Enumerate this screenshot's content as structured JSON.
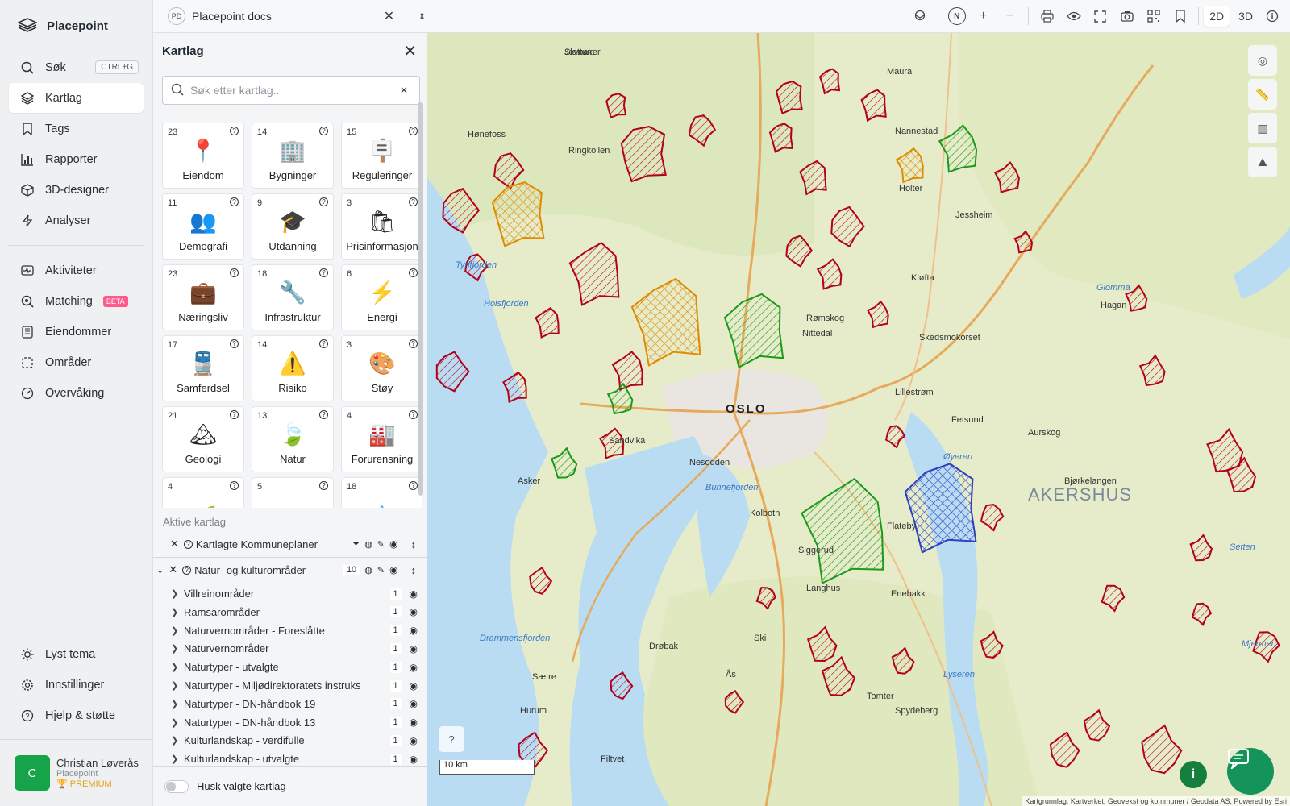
{
  "app": {
    "name": "Placepoint"
  },
  "nav": {
    "search": {
      "label": "Søk",
      "shortcut": "CTRL+G"
    },
    "items_top": [
      {
        "label": "Kartlag",
        "icon": "layers-icon",
        "active": true
      },
      {
        "label": "Tags",
        "icon": "bookmark-icon"
      },
      {
        "label": "Rapporter",
        "icon": "bar-chart-icon"
      },
      {
        "label": "3D-designer",
        "icon": "cube-icon"
      },
      {
        "label": "Analyser",
        "icon": "bolt-icon"
      }
    ],
    "items_mid": [
      {
        "label": "Aktiviteter",
        "icon": "activity-icon"
      },
      {
        "label": "Matching",
        "icon": "match-search-icon",
        "badge": "BETA"
      },
      {
        "label": "Eiendommer",
        "icon": "building-icon"
      },
      {
        "label": "Områder",
        "icon": "area-select-icon"
      },
      {
        "label": "Overvåking",
        "icon": "gauge-icon"
      }
    ],
    "items_bottom": [
      {
        "label": "Lyst tema",
        "icon": "sun-icon"
      },
      {
        "label": "Innstillinger",
        "icon": "gear-icon"
      },
      {
        "label": "Hjelp & støtte",
        "icon": "help-icon"
      }
    ]
  },
  "user": {
    "initial": "C",
    "name": "Christian Løverås",
    "org": "Placepoint",
    "plan": "PREMIUM"
  },
  "topbar": {
    "workspace_badge": "PD",
    "workspace_title": "Placepoint docs",
    "view_2d": "2D",
    "view_3d": "3D",
    "compass": "N"
  },
  "panel": {
    "title": "Kartlag",
    "search_placeholder": "Søk etter kartlag..",
    "categories": [
      {
        "count": "23",
        "label": "Eiendom",
        "emoji": "📍"
      },
      {
        "count": "14",
        "label": "Bygninger",
        "emoji": "🏢"
      },
      {
        "count": "15",
        "label": "Reguleringer",
        "emoji": "🪧"
      },
      {
        "count": "11",
        "label": "Demografi",
        "emoji": "👥"
      },
      {
        "count": "9",
        "label": "Utdanning",
        "emoji": "🎓"
      },
      {
        "count": "3",
        "label": "Prisinformasjon",
        "emoji": "🛍"
      },
      {
        "count": "23",
        "label": "Næringsliv",
        "emoji": "💼"
      },
      {
        "count": "18",
        "label": "Infrastruktur",
        "emoji": "🔧"
      },
      {
        "count": "6",
        "label": "Energi",
        "emoji": "⚡"
      },
      {
        "count": "17",
        "label": "Samferdsel",
        "emoji": "🚆"
      },
      {
        "count": "14",
        "label": "Risiko",
        "emoji": "⚠️"
      },
      {
        "count": "3",
        "label": "Støy",
        "emoji": "🎨"
      },
      {
        "count": "21",
        "label": "Geologi",
        "emoji": "🏔"
      },
      {
        "count": "13",
        "label": "Natur",
        "emoji": "🍃"
      },
      {
        "count": "4",
        "label": "Forurensning",
        "emoji": "🏭"
      },
      {
        "count": "4",
        "label": "",
        "emoji": "🌱"
      },
      {
        "count": "5",
        "label": "",
        "emoji": "🐟"
      },
      {
        "count": "18",
        "label": "",
        "emoji": "💧"
      }
    ],
    "active_title": "Aktive kartlag",
    "active_layers": [
      {
        "name": "Kartlagte Kommuneplaner"
      },
      {
        "name": "Natur- og kulturområder",
        "count": "10"
      }
    ],
    "sublayers": [
      {
        "name": "Villreinområder",
        "count": "1"
      },
      {
        "name": "Ramsarområder",
        "count": "1"
      },
      {
        "name": "Naturvernområder - Foreslåtte",
        "count": "1"
      },
      {
        "name": "Naturvernområder",
        "count": "1"
      },
      {
        "name": "Naturtyper - utvalgte",
        "count": "1"
      },
      {
        "name": "Naturtyper - Miljødirektoratets instruks",
        "count": "1"
      },
      {
        "name": "Naturtyper - DN-håndbok 19",
        "count": "1"
      },
      {
        "name": "Naturtyper - DN-håndbok 13",
        "count": "1"
      },
      {
        "name": "Kulturlandskap - verdifulle",
        "count": "1"
      },
      {
        "name": "Kulturlandskap - utvalgte",
        "count": "1"
      }
    ],
    "remember_label": "Husk valgte kartlag"
  },
  "map": {
    "scale_label": "10 km",
    "attribution": "Kartgrunnlag: Kartverket, Geovekst og kommuner / Geodata AS, Powered by Esri",
    "region_label": "AKERSHUS",
    "city_label": "OSLO",
    "places": [
      "Jevnaker",
      "Hønefoss",
      "Ringkollen",
      "Maura",
      "Nannestad",
      "Jessheim",
      "Kløfta",
      "Lillestrøm",
      "Fetsund",
      "Aurskog",
      "Bjørkelangen",
      "Asker",
      "Sandvika",
      "Nesodden",
      "Kolbotn",
      "Ski",
      "Drøbak",
      "Ås",
      "Hurum",
      "Spydeberg",
      "Tomter",
      "Enebakk",
      "Flateby",
      "Siggerud",
      "Langhus",
      "Sætre",
      "Filtvet",
      "Holter",
      "Hagan",
      "Skedsmokorset",
      "Rømskog",
      "Nittedal",
      "Slattum"
    ],
    "waters": [
      "Tyrifjorden",
      "Holsfjorden",
      "Bunnefjorden",
      "Drammensfjorden",
      "Øyeren",
      "Glomma",
      "Setten",
      "Lyseren",
      "Mjermen"
    ],
    "colors": {
      "property": "#b3001b",
      "plan": "#e08a00",
      "nature": "#1a9a1a",
      "ramsar": "#2b3fc0",
      "water": "#b9dcf2",
      "land": "#e6ecca"
    }
  }
}
